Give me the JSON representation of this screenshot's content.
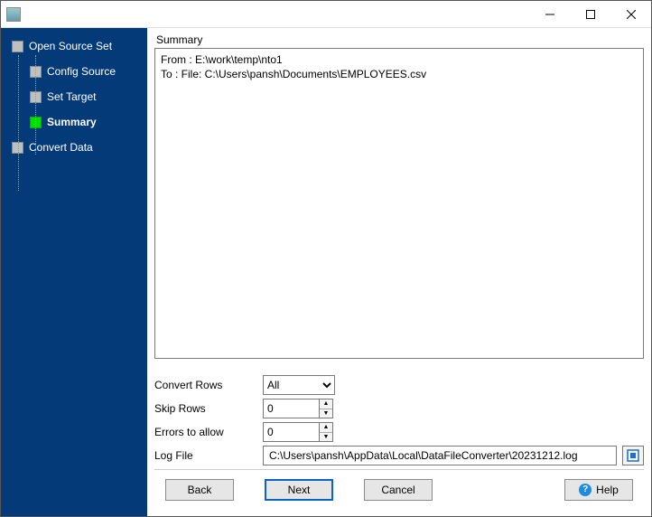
{
  "window": {
    "title": ""
  },
  "sidebar": {
    "items": [
      {
        "label": "Open Source Set"
      },
      {
        "label": "Config Source"
      },
      {
        "label": "Set Target"
      },
      {
        "label": "Summary"
      },
      {
        "label": "Convert Data"
      }
    ]
  },
  "main": {
    "section_label": "Summary",
    "summary_lines": {
      "from": "From : E:\\work\\temp\\nto1",
      "to": "To : File: C:\\Users\\pansh\\Documents\\EMPLOYEES.csv"
    },
    "convert_rows": {
      "label": "Convert Rows",
      "value": "All",
      "options": [
        "All"
      ]
    },
    "skip_rows": {
      "label": "Skip Rows",
      "value": "0"
    },
    "errors_to_allow": {
      "label": "Errors to allow",
      "value": "0"
    },
    "log_file": {
      "label": "Log File",
      "value": "C:\\Users\\pansh\\AppData\\Local\\DataFileConverter\\20231212.log"
    }
  },
  "footer": {
    "back": "Back",
    "next": "Next",
    "cancel": "Cancel",
    "help": "Help"
  }
}
